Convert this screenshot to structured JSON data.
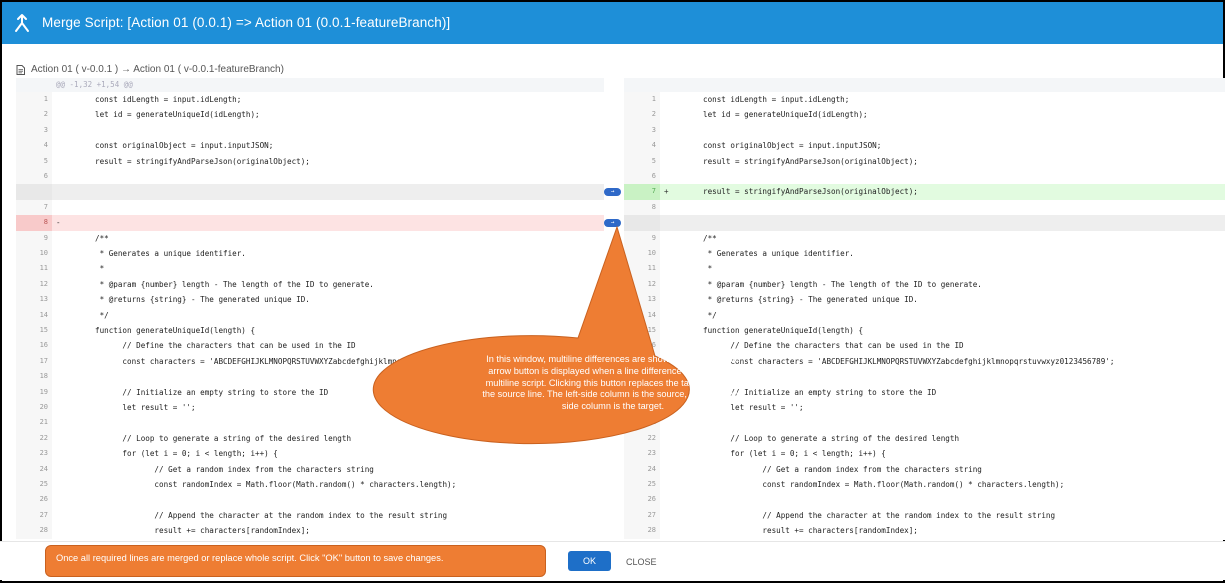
{
  "window": {
    "title": "Merge Script: [Action 01 (0.0.1) => Action 01 (0.0.1-featureBranch)]",
    "title_icon": "merge-icon",
    "accent": "#1e8fd8"
  },
  "breadcrumb": {
    "icon": "document-icon",
    "text": "Action 01 ( v-0.0.1 ) → Action 01 ( v-0.0.1-featureBranch)"
  },
  "diff": {
    "hunk_header": "@@ -1,32 +1,54 @@",
    "left": [
      {
        "num": "1",
        "sign": "",
        "type": "normal",
        "text": "const idLength = input.idLength;"
      },
      {
        "num": "2",
        "sign": "",
        "type": "normal",
        "text": "let id = generateUniqueId(idLength);"
      },
      {
        "num": "3",
        "sign": "",
        "type": "normal",
        "text": ""
      },
      {
        "num": "4",
        "sign": "",
        "type": "normal",
        "text": "const originalObject = input.inputJSON;"
      },
      {
        "num": "5",
        "sign": "",
        "type": "normal",
        "text": "result = stringifyAndParseJson(originalObject);"
      },
      {
        "num": "6",
        "sign": "",
        "type": "normal",
        "text": ""
      },
      {
        "num": "",
        "sign": "",
        "type": "empty",
        "text": ""
      },
      {
        "num": "7",
        "sign": "",
        "type": "normal",
        "text": ""
      },
      {
        "num": "8",
        "sign": "-",
        "type": "removed",
        "text": ""
      },
      {
        "num": "9",
        "sign": "",
        "type": "normal",
        "text": "/**"
      },
      {
        "num": "10",
        "sign": "",
        "type": "normal",
        "text": " * Generates a unique identifier."
      },
      {
        "num": "11",
        "sign": "",
        "type": "normal",
        "text": " *"
      },
      {
        "num": "12",
        "sign": "",
        "type": "normal",
        "text": " * @param {number} length - The length of the ID to generate."
      },
      {
        "num": "13",
        "sign": "",
        "type": "normal",
        "text": " * @returns {string} - The generated unique ID."
      },
      {
        "num": "14",
        "sign": "",
        "type": "normal",
        "text": " */"
      },
      {
        "num": "15",
        "sign": "",
        "type": "normal",
        "text": "function generateUniqueId(length) {"
      },
      {
        "num": "16",
        "sign": "",
        "type": "normal",
        "text": "      // Define the characters that can be used in the ID"
      },
      {
        "num": "17",
        "sign": "",
        "type": "normal",
        "text": "      const characters = 'ABCDEFGHIJKLMNOPQRSTUVWXYZabcdefghijklmnopqrstuvwxyz0123456789';"
      },
      {
        "num": "18",
        "sign": "",
        "type": "normal",
        "text": ""
      },
      {
        "num": "19",
        "sign": "",
        "type": "normal",
        "text": "      // Initialize an empty string to store the ID"
      },
      {
        "num": "20",
        "sign": "",
        "type": "normal",
        "text": "      let result = '';"
      },
      {
        "num": "21",
        "sign": "",
        "type": "normal",
        "text": ""
      },
      {
        "num": "22",
        "sign": "",
        "type": "normal",
        "text": "      // Loop to generate a string of the desired length"
      },
      {
        "num": "23",
        "sign": "",
        "type": "normal",
        "text": "      for (let i = 0; i < length; i++) {"
      },
      {
        "num": "24",
        "sign": "",
        "type": "normal",
        "text": "             // Get a random index from the characters string"
      },
      {
        "num": "25",
        "sign": "",
        "type": "normal",
        "text": "             const randomIndex = Math.floor(Math.random() * characters.length);"
      },
      {
        "num": "26",
        "sign": "",
        "type": "normal",
        "text": ""
      },
      {
        "num": "27",
        "sign": "",
        "type": "normal",
        "text": "             // Append the character at the random index to the result string"
      },
      {
        "num": "28",
        "sign": "",
        "type": "normal",
        "text": "             result += characters[randomIndex];"
      }
    ],
    "right": [
      {
        "num": "1",
        "sign": "",
        "type": "normal",
        "text": "const idLength = input.idLength;"
      },
      {
        "num": "2",
        "sign": "",
        "type": "normal",
        "text": "let id = generateUniqueId(idLength);"
      },
      {
        "num": "3",
        "sign": "",
        "type": "normal",
        "text": ""
      },
      {
        "num": "4",
        "sign": "",
        "type": "normal",
        "text": "const originalObject = input.inputJSON;"
      },
      {
        "num": "5",
        "sign": "",
        "type": "normal",
        "text": "result = stringifyAndParseJson(originalObject);"
      },
      {
        "num": "6",
        "sign": "",
        "type": "normal",
        "text": ""
      },
      {
        "num": "7",
        "sign": "+",
        "type": "added",
        "text": "result = stringifyAndParseJson(originalObject);"
      },
      {
        "num": "8",
        "sign": "",
        "type": "normal",
        "text": ""
      },
      {
        "num": "",
        "sign": "",
        "type": "empty",
        "text": ""
      },
      {
        "num": "9",
        "sign": "",
        "type": "normal",
        "text": "/**"
      },
      {
        "num": "10",
        "sign": "",
        "type": "normal",
        "text": " * Generates a unique identifier."
      },
      {
        "num": "11",
        "sign": "",
        "type": "normal",
        "text": " *"
      },
      {
        "num": "12",
        "sign": "",
        "type": "normal",
        "text": " * @param {number} length - The length of the ID to generate."
      },
      {
        "num": "13",
        "sign": "",
        "type": "normal",
        "text": " * @returns {string} - The generated unique ID."
      },
      {
        "num": "14",
        "sign": "",
        "type": "normal",
        "text": " */"
      },
      {
        "num": "15",
        "sign": "",
        "type": "normal",
        "text": "function generateUniqueId(length) {"
      },
      {
        "num": "16",
        "sign": "",
        "type": "normal",
        "text": "      // Define the characters that can be used in the ID"
      },
      {
        "num": "17",
        "sign": "",
        "type": "normal",
        "text": "      const characters = 'ABCDEFGHIJKLMNOPQRSTUVWXYZabcdefghijklmnopqrstuvwxyz0123456789';"
      },
      {
        "num": "18",
        "sign": "",
        "type": "normal",
        "text": ""
      },
      {
        "num": "19",
        "sign": "",
        "type": "normal",
        "text": "      // Initialize an empty string to store the ID"
      },
      {
        "num": "20",
        "sign": "",
        "type": "normal",
        "text": "      let result = '';"
      },
      {
        "num": "21",
        "sign": "",
        "type": "normal",
        "text": ""
      },
      {
        "num": "22",
        "sign": "",
        "type": "normal",
        "text": "      // Loop to generate a string of the desired length"
      },
      {
        "num": "23",
        "sign": "",
        "type": "normal",
        "text": "      for (let i = 0; i < length; i++) {"
      },
      {
        "num": "24",
        "sign": "",
        "type": "normal",
        "text": "             // Get a random index from the characters string"
      },
      {
        "num": "25",
        "sign": "",
        "type": "normal",
        "text": "             const randomIndex = Math.floor(Math.random() * characters.length);"
      },
      {
        "num": "26",
        "sign": "",
        "type": "normal",
        "text": ""
      },
      {
        "num": "27",
        "sign": "",
        "type": "normal",
        "text": "             // Append the character at the random index to the result string"
      },
      {
        "num": "28",
        "sign": "",
        "type": "normal",
        "text": "             result += characters[randomIndex];"
      }
    ],
    "arrow_buttons": [
      {
        "row": 6,
        "label": "→",
        "icon": "arrow-right-icon"
      },
      {
        "row": 8,
        "label": "→",
        "icon": "arrow-right-icon"
      }
    ]
  },
  "callouts": {
    "middle": "In this window, multiline differences are shown, and the middle arrow button is displayed when a line difference occurs in this multiline script. Clicking this button replaces the target line with the source line. The left-side column is the source, and the right-side column is the target.",
    "bottom": "Once all required lines are merged or replace whole script. Click \"OK\" button to save changes.",
    "color": "#ee7d33"
  },
  "footer": {
    "ok_label": "OK",
    "close_label": "CLOSE"
  }
}
